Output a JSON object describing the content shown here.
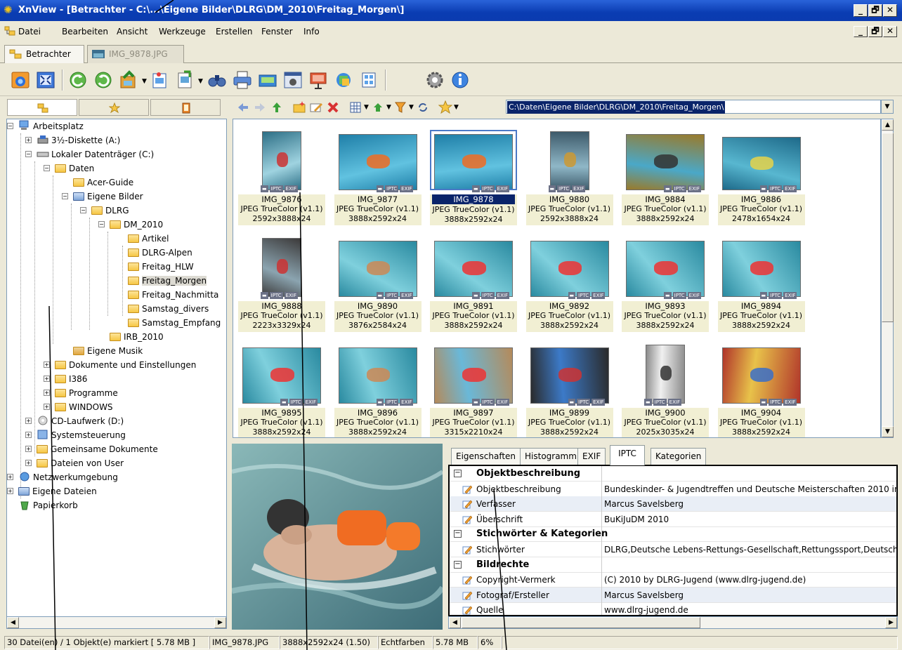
{
  "window": {
    "title": "XnView - [Betrachter - C:\\...\\Eigene Bilder\\DLRG\\DM_2010\\Freitag_Morgen\\]"
  },
  "menu": [
    "Datei",
    "Bearbeiten",
    "Ansicht",
    "Werkzeuge",
    "Erstellen",
    "Fenster",
    "Info"
  ],
  "doc_tabs": [
    "Betrachter",
    "IMG_9878.JPG"
  ],
  "toolbar_icons": [
    "fullscreen-icon",
    "fit-window-icon",
    "rotate-left-icon",
    "rotate-right-icon",
    "convert-icon",
    "slideshow-icon",
    "export-icon",
    "search-icon",
    "print-icon",
    "scan-icon",
    "capture-icon",
    "webpage-icon",
    "multipage-icon",
    "contact-sheet-icon",
    "settings-icon",
    "info-icon"
  ],
  "path": "C:\\Daten\\Eigene Bilder\\DLRG\\DM_2010\\Freitag_Morgen\\",
  "tree": [
    {
      "label": "Arbeitsplatz"
    },
    {
      "label": "3½-Diskette (A:)"
    },
    {
      "label": "Lokaler Datenträger (C:)"
    },
    {
      "label": "Daten"
    },
    {
      "label": "Acer-Guide"
    },
    {
      "label": "Eigene Bilder"
    },
    {
      "label": "DLRG"
    },
    {
      "label": "DM_2010"
    },
    {
      "label": "Artikel"
    },
    {
      "label": "DLRG-Alpen"
    },
    {
      "label": "Freitag_HLW"
    },
    {
      "label": "Freitag_Morgen"
    },
    {
      "label": "Freitag_Nachmitta"
    },
    {
      "label": "Samstag_divers"
    },
    {
      "label": "Samstag_Empfang"
    },
    {
      "label": "IRB_2010"
    },
    {
      "label": "Eigene Musik"
    },
    {
      "label": "Dokumente und Einstellungen"
    },
    {
      "label": "I386"
    },
    {
      "label": "Programme"
    },
    {
      "label": "WINDOWS"
    },
    {
      "label": "CD-Laufwerk (D:)"
    },
    {
      "label": "Systemsteuerung"
    },
    {
      "label": "Gemeinsame Dokumente"
    },
    {
      "label": "Dateien von User"
    },
    {
      "label": "Netzwerkumgebung"
    },
    {
      "label": "Eigene Dateien"
    },
    {
      "label": "Papierkorb"
    }
  ],
  "thumbs": [
    {
      "name": "IMG_9876",
      "type": "JPEG TrueColor (v1.1)",
      "dims": "2592x3888x24"
    },
    {
      "name": "IMG_9877",
      "type": "JPEG TrueColor (v1.1)",
      "dims": "3888x2592x24"
    },
    {
      "name": "IMG_9878",
      "type": "JPEG TrueColor (v1.1)",
      "dims": "3888x2592x24"
    },
    {
      "name": "IMG_9880",
      "type": "JPEG TrueColor (v1.1)",
      "dims": "2592x3888x24"
    },
    {
      "name": "IMG_9884",
      "type": "JPEG TrueColor (v1.1)",
      "dims": "3888x2592x24"
    },
    {
      "name": "IMG_9886",
      "type": "JPEG TrueColor (v1.1)",
      "dims": "2478x1654x24"
    },
    {
      "name": "IMG_9888",
      "type": "JPEG TrueColor (v1.1)",
      "dims": "2223x3329x24"
    },
    {
      "name": "IMG_9890",
      "type": "JPEG TrueColor (v1.1)",
      "dims": "3876x2584x24"
    },
    {
      "name": "IMG_9891",
      "type": "JPEG TrueColor (v1.1)",
      "dims": "3888x2592x24"
    },
    {
      "name": "IMG_9892",
      "type": "JPEG TrueColor (v1.1)",
      "dims": "3888x2592x24"
    },
    {
      "name": "IMG_9893",
      "type": "JPEG TrueColor (v1.1)",
      "dims": "3888x2592x24"
    },
    {
      "name": "IMG_9894",
      "type": "JPEG TrueColor (v1.1)",
      "dims": "3888x2592x24"
    },
    {
      "name": "IMG_9895",
      "type": "JPEG TrueColor (v1.1)",
      "dims": "3888x2592x24"
    },
    {
      "name": "IMG_9896",
      "type": "JPEG TrueColor (v1.1)",
      "dims": "3888x2592x24"
    },
    {
      "name": "IMG_9897",
      "type": "JPEG TrueColor (v1.1)",
      "dims": "3315x2210x24"
    },
    {
      "name": "IMG_9899",
      "type": "JPEG TrueColor (v1.1)",
      "dims": "3888x2592x24"
    },
    {
      "name": "IMG_9900",
      "type": "JPEG TrueColor (v1.1)",
      "dims": "2025x3035x24"
    },
    {
      "name": "IMG_9904",
      "type": "JPEG TrueColor (v1.1)",
      "dims": "3888x2592x24"
    }
  ],
  "badges": {
    "iptc": "IPTC",
    "exif": "EXIF"
  },
  "prop_tabs": [
    "Eigenschaften",
    "Histogramm",
    "EXIF",
    "IPTC",
    "Kategorien"
  ],
  "props": [
    {
      "group": "Objektbeschreibung"
    },
    {
      "key": "Objektbeschreibung",
      "value": "Bundeskinder- & Jugendtreffen und Deutsche Meisterschaften 2010 in"
    },
    {
      "key": "Verfasser",
      "value": "Marcus Savelsberg"
    },
    {
      "key": "Überschrift",
      "value": "BuKiJuDM 2010"
    },
    {
      "group": "Stichwörter & Kategorien"
    },
    {
      "key": "Stichwörter",
      "value": "DLRG,Deutsche Lebens-Rettungs-Gesellschaft,Rettungssport,Deutsch"
    },
    {
      "group": "Bildrechte"
    },
    {
      "key": "Copyright-Vermerk",
      "value": "(C) 2010 by DLRG-Jugend (www.dlrg-jugend.de)"
    },
    {
      "key": "Fotograf/Ersteller",
      "value": "Marcus Savelsberg"
    },
    {
      "key": "Quelle",
      "value": "www.dlrg-jugend.de"
    }
  ],
  "status": [
    "30 Datei(en) / 1 Objekt(e) markiert  [ 5.78 MB ]",
    "IMG_9878.JPG",
    "3888x2592x24 (1.50)",
    "Echtfarben",
    "5.78 MB",
    "6%"
  ]
}
